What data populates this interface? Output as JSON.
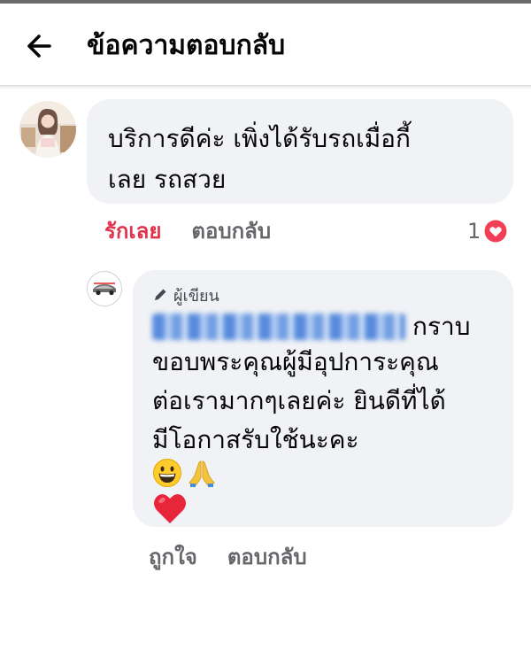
{
  "header": {
    "title": "ข้อความตอบกลับ",
    "back_icon": "arrow-left-icon"
  },
  "colors": {
    "liked": "#e0344d",
    "muted": "#65676b",
    "bubble": "#f0f2f5"
  },
  "comment": {
    "avatar_icon": "user-avatar",
    "text": "บริการดีค่ะ เพิ่งได้รับรถเมื่อกี้\nเลย รถสวย",
    "actions": {
      "like": "รักเลย",
      "reply": "ตอบกลับ"
    },
    "reaction_count": "1",
    "reaction_icon": "heart-icon"
  },
  "reply": {
    "avatar_icon": "page-logo-avatar",
    "author_badge": "ผู้เขียน",
    "badge_icon": "pencil-icon",
    "mention_suffix": "กราบ",
    "text": "ขอบพระคุณผู้มีอุปการะคุณ\nต่อเรามากๆเลยค่ะ ยินดีที่ได้\nมีโอกาสรับใช้นะคะ",
    "emojis": [
      "grinning-face-emoji",
      "folded-hands-emoji",
      "red-heart-emoji"
    ],
    "actions": {
      "like": "ถูกใจ",
      "reply": "ตอบกลับ"
    }
  }
}
